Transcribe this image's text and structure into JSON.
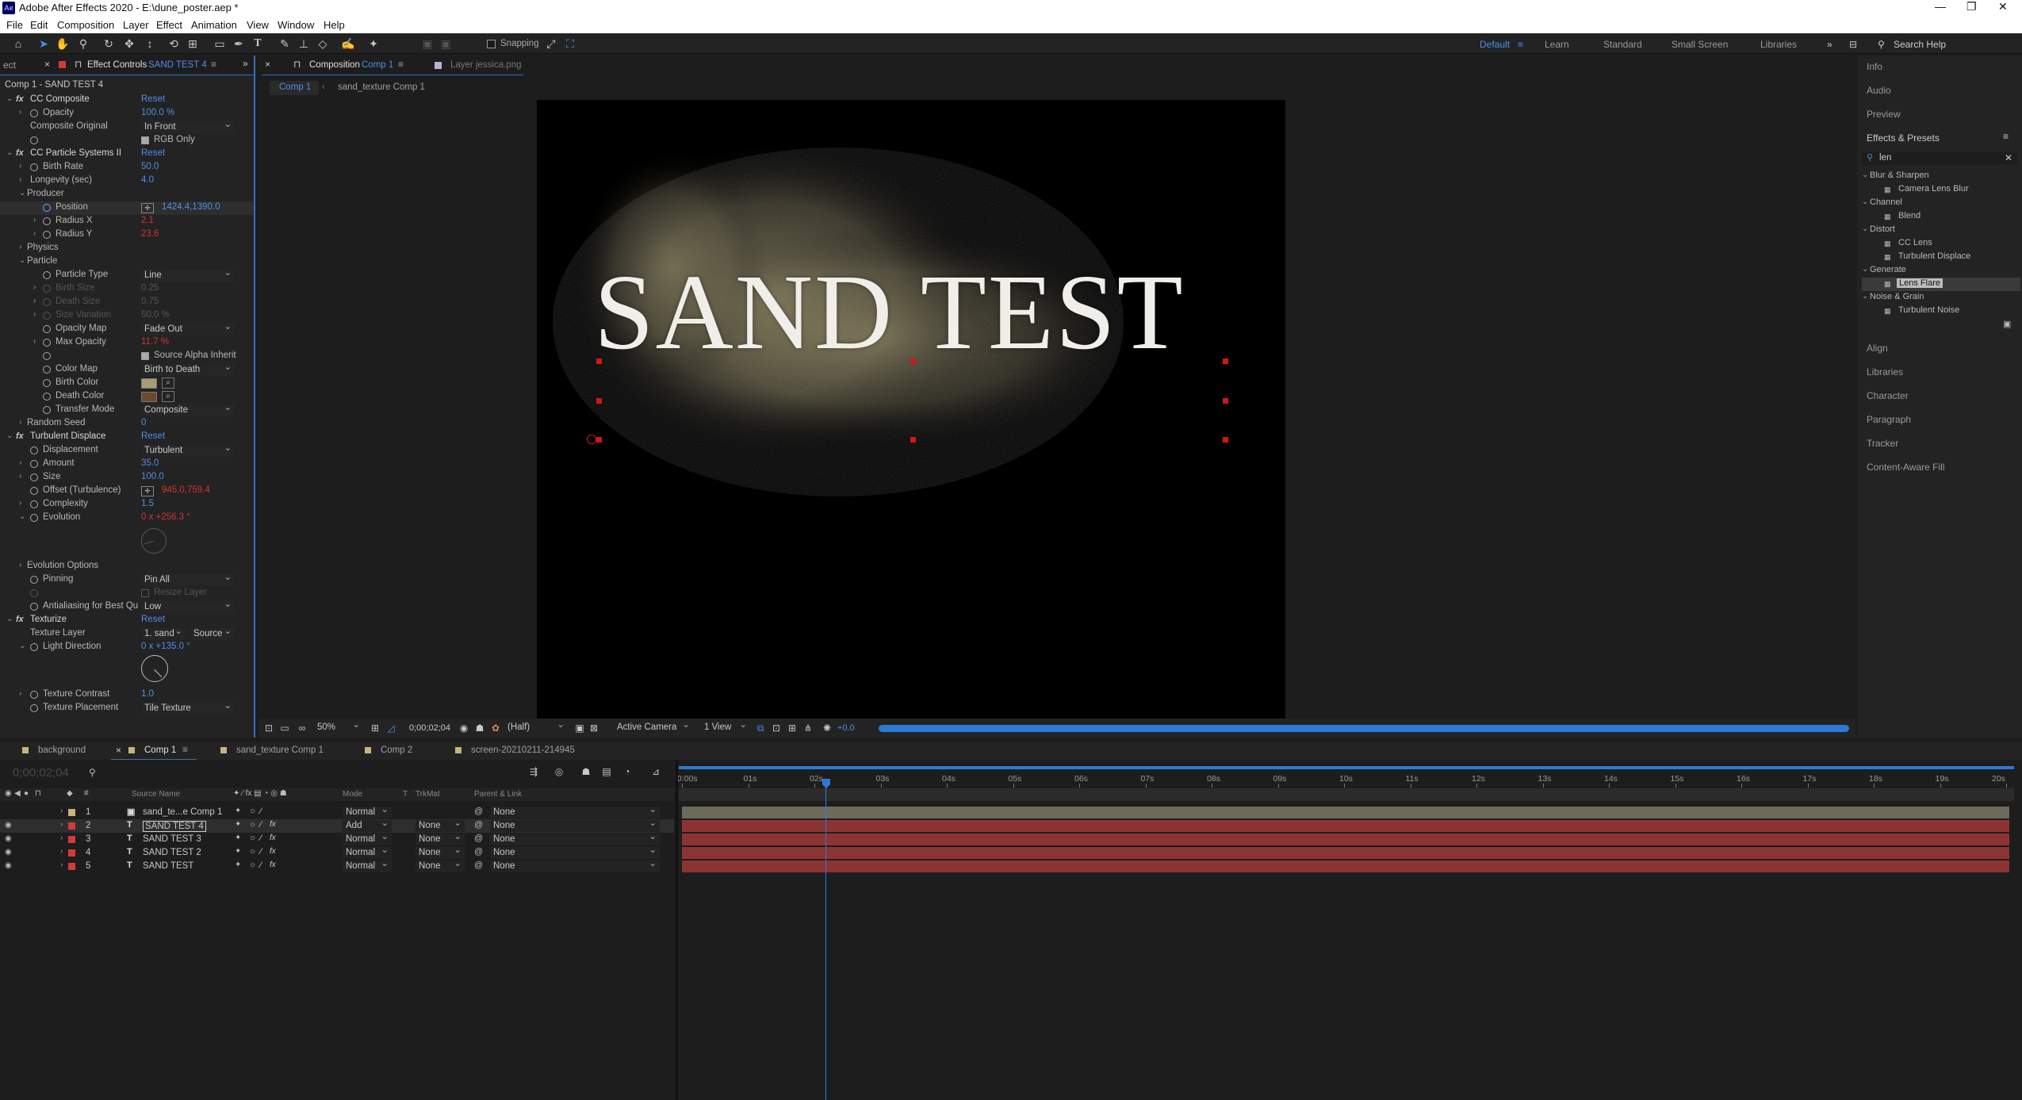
{
  "app": {
    "title": "Adobe After Effects 2020 - E:\\dune_poster.aep *",
    "logo": "Ae"
  },
  "menu": [
    "File",
    "Edit",
    "Composition",
    "Layer",
    "Effect",
    "Animation",
    "View",
    "Window",
    "Help"
  ],
  "toolbar": {
    "snapping": "Snapping",
    "workspaces": [
      "Default",
      "Learn",
      "Standard",
      "Small Screen",
      "Libraries"
    ],
    "search_help": "Search Help"
  },
  "effect_controls": {
    "tab_label": "Effect Controls",
    "tab_layer": "SAND TEST 4",
    "prev_tab": "ect",
    "layer_path": "Comp 1 - SAND TEST 4",
    "reset": "Reset",
    "cc_composite": {
      "name": "CC Composite",
      "opacity_label": "Opacity",
      "opacity_value": "100.0 %",
      "composite_original_label": "Composite Original",
      "composite_original_value": "In Front",
      "rgb_only": "RGB Only"
    },
    "particle_systems": {
      "name": "CC Particle Systems II",
      "birth_rate_label": "Birth Rate",
      "birth_rate_value": "50.0",
      "longevity_label": "Longevity (sec)",
      "longevity_value": "4.0",
      "producer": "Producer",
      "position_label": "Position",
      "position_value": "1424.4,1390.0",
      "radius_x_label": "Radius X",
      "radius_x_value": "2.1",
      "radius_y_label": "Radius Y",
      "radius_y_value": "23.6",
      "physics": "Physics",
      "particle": "Particle",
      "particle_type_label": "Particle Type",
      "particle_type_value": "Line",
      "birth_size_label": "Birth Size",
      "birth_size_value": "0.25",
      "death_size_label": "Death Size",
      "death_size_value": "0.75",
      "size_variation_label": "Size Variation",
      "size_variation_value": "50.0 %",
      "opacity_map_label": "Opacity Map",
      "opacity_map_value": "Fade Out",
      "max_opacity_label": "Max Opacity",
      "max_opacity_value": "11.7 %",
      "source_alpha": "Source Alpha Inherit",
      "color_map_label": "Color Map",
      "color_map_value": "Birth to Death",
      "birth_color_label": "Birth Color",
      "birth_color": "#a89c72",
      "death_color_label": "Death Color",
      "death_color": "#6b4a30",
      "transfer_mode_label": "Transfer Mode",
      "transfer_mode_value": "Composite",
      "random_seed_label": "Random Seed",
      "random_seed_value": "0"
    },
    "turbulent_displace": {
      "name": "Turbulent Displace",
      "displacement_label": "Displacement",
      "displacement_value": "Turbulent",
      "amount_label": "Amount",
      "amount_value": "35.0",
      "size_label": "Size",
      "size_value": "100.0",
      "offset_label": "Offset (Turbulence)",
      "offset_value": "945.0,759.4",
      "complexity_label": "Complexity",
      "complexity_value": "1.5",
      "evolution_label": "Evolution",
      "evolution_value": "0 x +256.3 °",
      "evolution_options": "Evolution Options",
      "pinning_label": "Pinning",
      "pinning_value": "Pin All",
      "resize_layer": "Resize Layer",
      "antialiasing_label": "Antialiasing for Best Qu",
      "antialiasing_value": "Low"
    },
    "texturize": {
      "name": "Texturize",
      "texture_layer_label": "Texture Layer",
      "texture_layer_value": "1. sand",
      "texture_layer_source": "Source",
      "light_direction_label": "Light Direction",
      "light_direction_value": "0 x +135.0 °",
      "texture_contrast_label": "Texture Contrast",
      "texture_contrast_value": "1.0",
      "texture_placement_label": "Texture Placement",
      "texture_placement_value": "Tile Texture"
    }
  },
  "composition_panel": {
    "tab_label": "Composition",
    "tab_comp": "Comp 1",
    "layer_tab": "Layer  jessica.png",
    "breadcrumbs": [
      "Comp 1",
      "sand_texture Comp 1"
    ],
    "canvas_text": "SAND TEST",
    "footer": {
      "zoom": "50%",
      "timecode": "0;00;02;04",
      "resolution": "(Half)",
      "camera": "Active Camera",
      "views": "1 View",
      "exposure": "+0.0"
    }
  },
  "right_panel": {
    "info": "Info",
    "audio": "Audio",
    "preview": "Preview",
    "effects_presets": "Effects & Presets",
    "search_value": "len",
    "tree": [
      {
        "category": "Blur & Sharpen",
        "items": [
          "Camera Lens Blur"
        ]
      },
      {
        "category": "Channel",
        "items": [
          "Blend"
        ]
      },
      {
        "category": "Distort",
        "items": [
          "CC Lens",
          "Turbulent Displace"
        ]
      },
      {
        "category": "Generate",
        "items": [
          "Lens Flare"
        ]
      },
      {
        "category": "Noise & Grain",
        "items": [
          "Turbulent Noise"
        ]
      }
    ],
    "bottom": [
      "Align",
      "Libraries",
      "Character",
      "Paragraph",
      "Tracker",
      "Content-Aware Fill"
    ]
  },
  "timeline": {
    "tabs": [
      "background",
      "Comp 1",
      "sand_texture Comp 1",
      "Comp 2",
      "screen-20210211-214945"
    ],
    "timecode": "0;00;02;04",
    "headers": {
      "source_name": "Source Name",
      "mode": "Mode",
      "t": "T",
      "trkmat": "TrkMat",
      "parent": "Parent & Link"
    },
    "layers": [
      {
        "num": "1",
        "name": "sand_te...e Comp 1",
        "type": "comp",
        "mode": "Normal",
        "trkmat": "",
        "parent": "None",
        "color": "#c7b57d",
        "selected": false
      },
      {
        "num": "2",
        "name": "SAND TEST 4",
        "type": "text",
        "mode": "Add",
        "trkmat": "None",
        "parent": "None",
        "color": "#d23b3b",
        "selected": true
      },
      {
        "num": "3",
        "name": "SAND TEST 3",
        "type": "text",
        "mode": "Normal",
        "trkmat": "None",
        "parent": "None",
        "color": "#d23b3b",
        "selected": false
      },
      {
        "num": "4",
        "name": "SAND TEST 2",
        "type": "text",
        "mode": "Normal",
        "trkmat": "None",
        "parent": "None",
        "color": "#d23b3b",
        "selected": false
      },
      {
        "num": "5",
        "name": "SAND TEST",
        "type": "text",
        "mode": "Normal",
        "trkmat": "None",
        "parent": "None",
        "color": "#d23b3b",
        "selected": false
      }
    ],
    "ruler": [
      "0:00s",
      "01s",
      "02s",
      "03s",
      "04s",
      "05s",
      "06s",
      "07s",
      "08s",
      "09s",
      "10s",
      "11s",
      "12s",
      "13s",
      "14s",
      "15s",
      "16s",
      "17s",
      "18s",
      "19s",
      "20s"
    ]
  }
}
